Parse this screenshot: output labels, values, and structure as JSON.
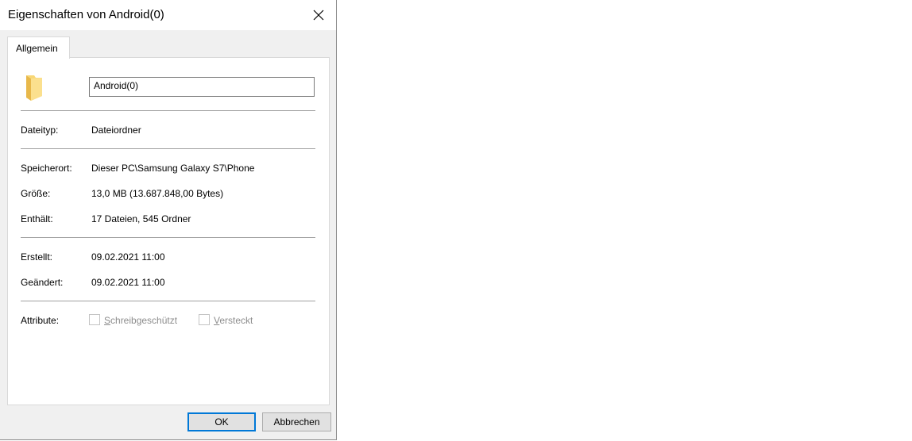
{
  "window": {
    "title": "Eigenschaften von Android(0)"
  },
  "tabs": [
    {
      "label": "Allgemein"
    }
  ],
  "general": {
    "name": "Android(0)",
    "file_type_label": "Dateityp:",
    "file_type_value": "Dateiordner",
    "location_label": "Speicherort:",
    "location_value": "Dieser PC\\Samsung Galaxy S7\\Phone",
    "size_label": "Größe:",
    "size_value": "13,0 MB (13.687.848,00 Bytes)",
    "contains_label": "Enthält:",
    "contains_value": "17 Dateien, 545 Ordner",
    "created_label": "Erstellt:",
    "created_value": "09.02.2021 11:00",
    "modified_label": "Geändert:",
    "modified_value": "09.02.2021 11:00",
    "attributes_label": "Attribute:",
    "readonly_hotkey": "S",
    "readonly_rest": "chreibgeschützt",
    "hidden_hotkey": "V",
    "hidden_rest": "ersteckt"
  },
  "buttons": {
    "ok": "OK",
    "cancel": "Abbrechen"
  },
  "icons": {
    "folder": "folder-icon",
    "close": "close-icon"
  },
  "colors": {
    "accent": "#0078d7",
    "folder": "#f8d775",
    "disabled_text": "#8d8d8d"
  }
}
